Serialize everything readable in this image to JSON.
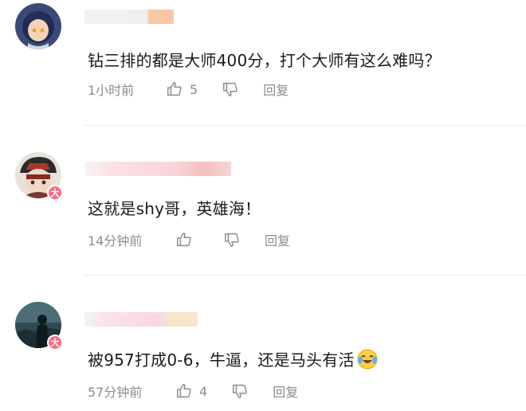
{
  "comments": [
    {
      "text": "钻三排的都是大师400分，打个大师有这么难吗？",
      "time": "1小时前",
      "likes": "5",
      "reply_label": "回复",
      "avatar_icon": "anime-girl-avatar",
      "badge": ""
    },
    {
      "text": "这就是shy哥，英雄海！",
      "time": "14分钟前",
      "likes": "",
      "reply_label": "回复",
      "avatar_icon": "cartoon-character-avatar",
      "badge": "大"
    },
    {
      "text": "被957打成0-6，牛逼，还是马头有活",
      "time": "57分钟前",
      "likes": "4",
      "reply_label": "回复",
      "avatar_icon": "night-figure-avatar",
      "badge": "大",
      "emoji_icon": "laughing-crying-emoji"
    }
  ],
  "colors": {
    "text": "#1a1a1a",
    "meta": "#8c8c8c",
    "badge": "#ff6a7f",
    "divider": "#ececec"
  }
}
